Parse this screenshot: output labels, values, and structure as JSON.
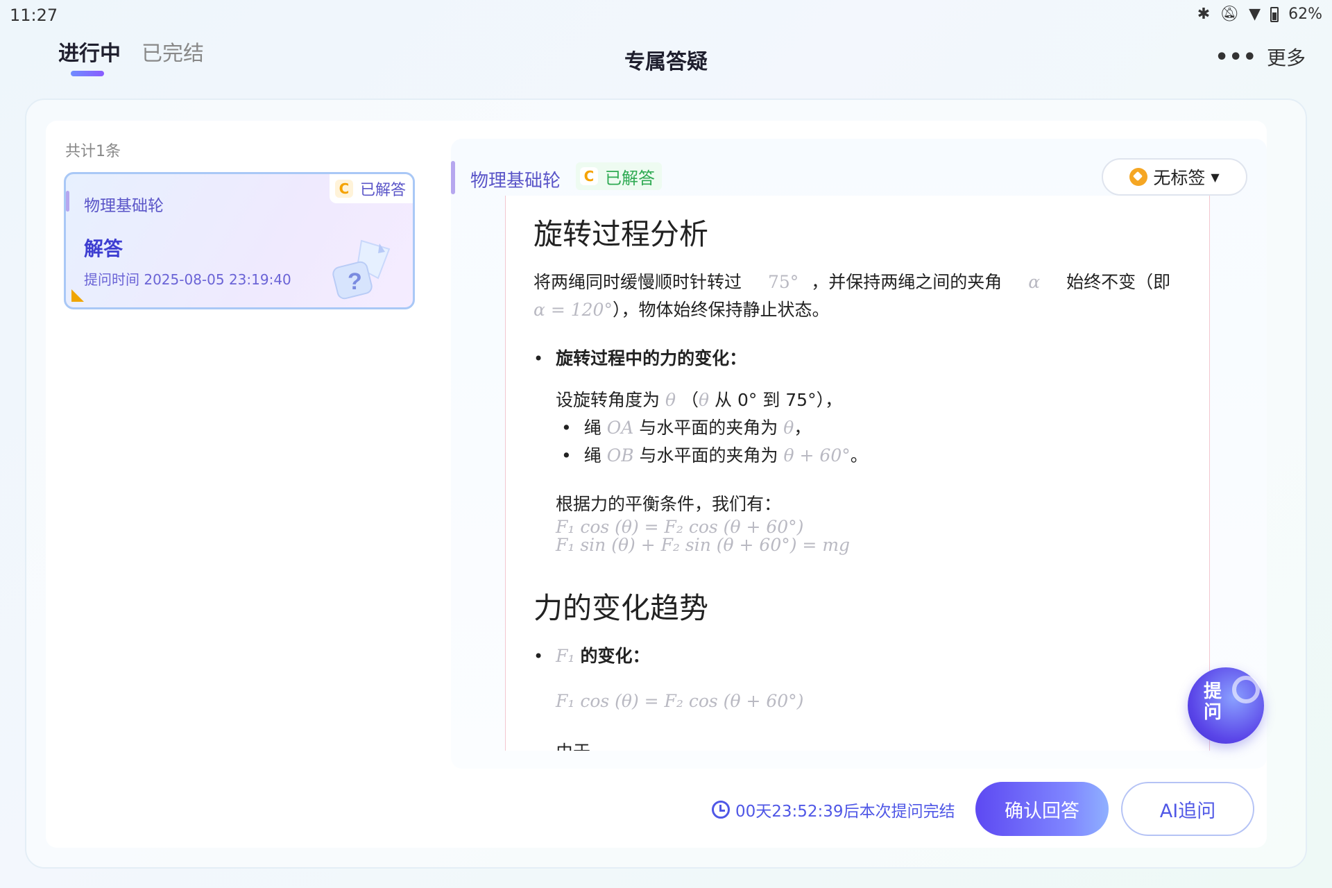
{
  "status_bar": {
    "time": "11:27",
    "battery": "62%"
  },
  "nav": {
    "tabs": [
      {
        "label": "进行中"
      },
      {
        "label": "已完结"
      }
    ],
    "title": "专属答疑",
    "more_label": "更多"
  },
  "list": {
    "count_text": "共计1条",
    "cards": [
      {
        "subject": "物理基础轮",
        "status_badge": "C",
        "status": "已解答",
        "title": "解答",
        "time": "提问时间 2025-08-05 23:19:40"
      }
    ]
  },
  "detail": {
    "subject": "物理基础轮",
    "status_badge": "C",
    "status": "已解答",
    "tag_label": "无标签",
    "content": {
      "h1": "旋转过程分析",
      "p1_a": "将两绳同时缓慢顺时针转过",
      "p1_m1": "75°",
      "p1_b": "，并保持两绳之间的夹角",
      "p1_m2": "α",
      "p1_c": "始终不变（即",
      "p1_m3": "α = 120°",
      "p1_d": "），物体始终保持静止状态。",
      "bullet1": "旋转过程中的力的变化：",
      "b1_line_a": "设旋转角度为",
      "b1_theta": "θ",
      "b1_line_b": "（",
      "b1_line_c": "从 0° 到 75°），",
      "sub1_a": "绳",
      "sub1_m": "OA",
      "sub1_b": "与水平面的夹角为",
      "sub1_theta": "θ",
      "sub1_c": "，",
      "sub2_a": "绳",
      "sub2_m": "OB",
      "sub2_b": "与水平面的夹角为",
      "sub2_expr": "θ + 60°",
      "sub2_c": "。",
      "balance": "根据力的平衡条件，我们有：",
      "eq1": "F₁ cos (θ) = F₂ cos (θ + 60°)",
      "eq2": "F₁ sin (θ) + F₂ sin (θ + 60°) = mg",
      "h2": "力的变化趋势",
      "bullet2_m": "F₁",
      "bullet2": "的变化：",
      "eq3": "F₁ cos (θ) = F₂ cos (θ + 60°)",
      "since": "由于"
    }
  },
  "ask_float_label": "提问",
  "footer": {
    "timer": "00天23:52:39后本次提问完结",
    "confirm_label": "确认回答",
    "ai_label": "AI追问"
  },
  "colors": {
    "accent": "#5a55c8",
    "primary_button": "#5d49f2",
    "answered_green": "#2eaa52",
    "badge_orange": "#f5a200"
  }
}
